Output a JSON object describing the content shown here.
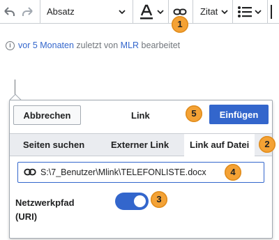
{
  "toolbar": {
    "undo_icon": "undo-icon",
    "redo_icon": "redo-icon",
    "format_select": "Absatz",
    "text_style_icon": "text-style-A-icon",
    "link_icon": "link-icon",
    "cite_label": "Zitat",
    "list_icon": "bulleted-list-icon"
  },
  "edit_info": {
    "time_link": "vor 5 Monaten",
    "middle_text": "zuletzt von",
    "user_link": "MLR",
    "end_text": "bearbeitet"
  },
  "dialog": {
    "cancel_label": "Abbrechen",
    "title": "Link",
    "insert_label": "Einfügen",
    "tabs": [
      "Seiten suchen",
      "Externer Link",
      "Link auf Datei"
    ],
    "active_tab": "Link auf Datei",
    "url_value": "S:\\7_Benutzer\\Mlink\\TELEFONLISTE.docx",
    "network_path_label_line1": "Netzwerkpfad",
    "network_path_label_line2": "(URI)",
    "network_path_toggle_on": true
  },
  "markers": {
    "m1": "1",
    "m2": "2",
    "m3": "3",
    "m4": "4",
    "m5": "5"
  },
  "colors": {
    "accent": "#3366cc",
    "marker": "#f4a235",
    "border": "#a2a9b1"
  }
}
